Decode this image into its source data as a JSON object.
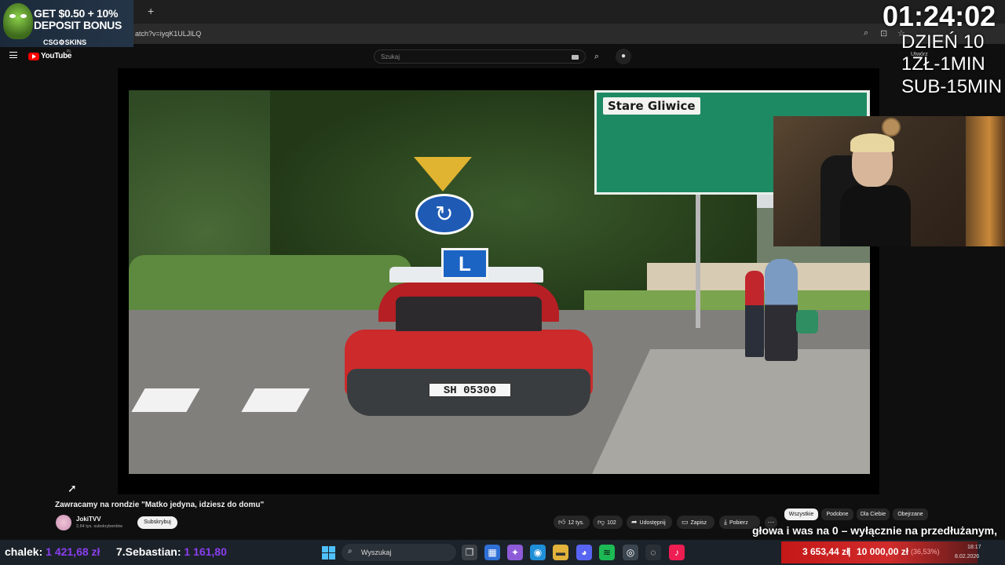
{
  "browser": {
    "url_partial": "atch?v=iyqK1ULJlLQ",
    "new_tab_glyph": "+"
  },
  "youtube": {
    "wordmark": "YouTube",
    "region": "PL",
    "search_placeholder": "Szukaj",
    "create_label": "Utwórz"
  },
  "overlay": {
    "ad_line1": "GET $0.50 + 10%",
    "ad_line2": "DEPOSIT BONUS",
    "ad_brand": "CSG⚙SKINS",
    "timer": "01:24:02",
    "dzien": "DZIEŃ 10",
    "rate1": "1ZŁ-1MIN",
    "rate2": "SUB-15MIN",
    "marquee": "głowa i was na 0 – wyłącznie na przedłużanym,"
  },
  "video_scene": {
    "sign_text": "Stare Gliwice",
    "learner_letter": "L",
    "plate": "SH 05300"
  },
  "video": {
    "title": "Zawracamy na rondzie \"Matko jedyna, idziesz do domu\"",
    "channel": "JokiTVV",
    "subscribers": "2,64 tys. subskrybentów",
    "subscribe_label": "Subskrybuj",
    "likes": "12 tys.",
    "dislikes": "102",
    "share_label": "Udostępnij",
    "save_label": "Zapisz",
    "download_label": "Pobierz",
    "more_label": "···"
  },
  "chips": [
    "Wszystkie",
    "Podobne",
    "Dla Ciebie",
    "Obejrzane"
  ],
  "donations": {
    "d1_name": "chalek:",
    "d1_amount": "1 421,68 zł",
    "d2_name": "7.Sebastian:",
    "d2_amount": "1 161,80"
  },
  "taskbar": {
    "search_placeholder": "Wyszukaj",
    "goal_current": "3 653,44 zł",
    "goal_sep": "|",
    "goal_target": "10 000,00 zł",
    "goal_tail": "(36,53%)",
    "time": "18:17",
    "date": "8.02.2026"
  },
  "colors": {
    "accent_red": "#ff0000",
    "donation_purple": "#8b3ff0",
    "sign_green": "#1d8a64"
  }
}
